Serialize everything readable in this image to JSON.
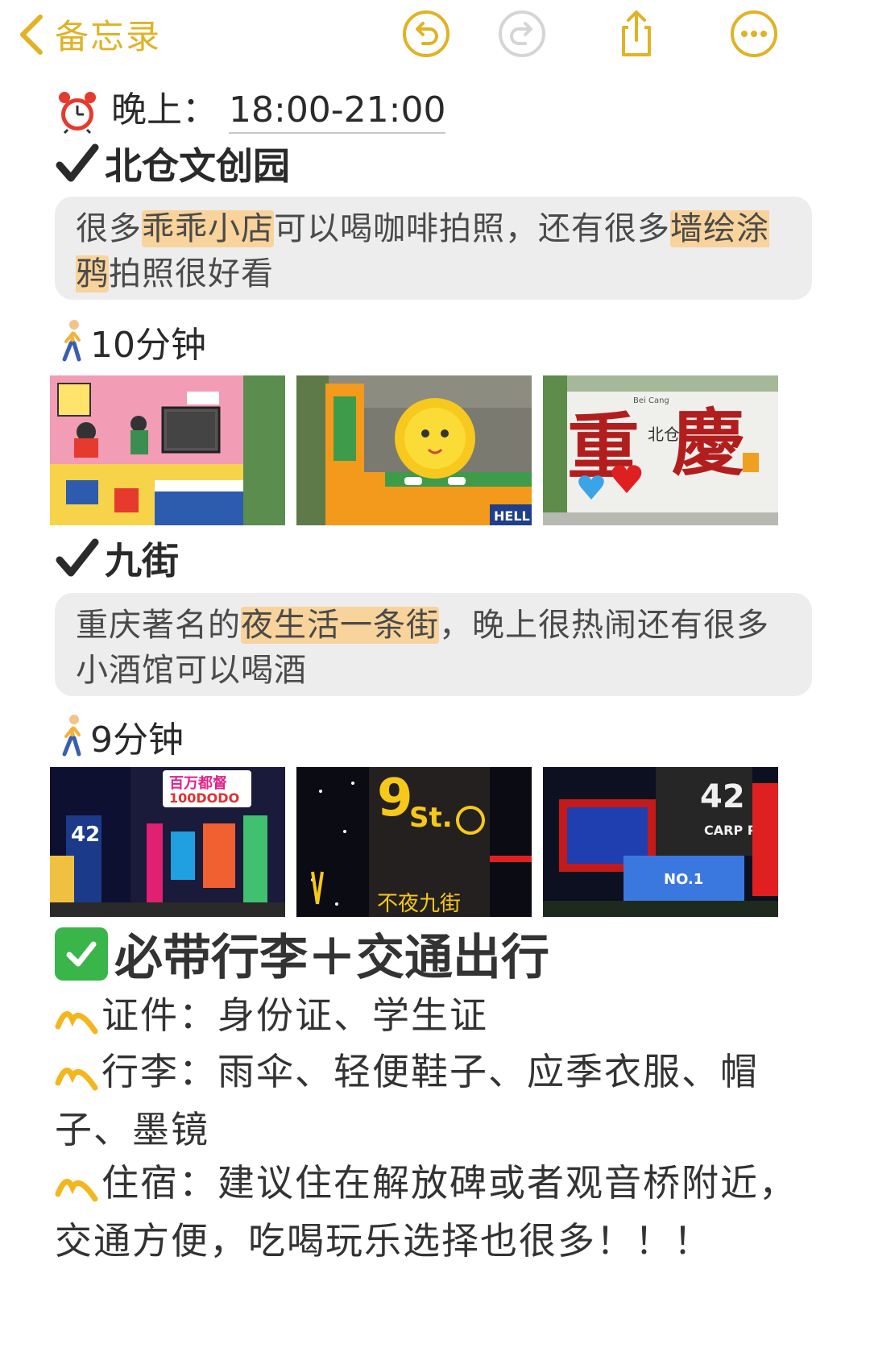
{
  "nav": {
    "back_label": "备忘录",
    "accent_color": "#e0b325",
    "icons": [
      "undo-icon",
      "redo-icon",
      "share-icon",
      "more-icon"
    ]
  },
  "schedule": {
    "time_prefix": "晚上：",
    "time_value": "18:00-21:00"
  },
  "spots": [
    {
      "name": "北仓文创园",
      "desc_parts": [
        "很多",
        "乖乖小店",
        "可以喝咖啡拍照，还有很多",
        "墙绘涂鸦",
        "拍照很好看"
      ],
      "walk_time": "10分钟",
      "photos": [
        "pink-mural-photo",
        "yellow-flower-sculpture-photo",
        "chongqing-beicang-sign-photo"
      ],
      "sign_text": [
        "重",
        "北仓",
        "慶",
        "Bei Cang"
      ],
      "photo_text": [
        "HELL"
      ]
    },
    {
      "name": "九街",
      "desc_parts": [
        "重庆著名的",
        "夜生活一条街",
        "，晚上很热闹还有很多小酒馆可以喝酒"
      ],
      "walk_time": "9分钟",
      "photos": [
        "neon-street-photo",
        "9st-sign-photo",
        "42-carp-pond-photo"
      ],
      "photo_text": [
        "百万都督",
        "100DODO",
        "42",
        "CARP POND",
        "9",
        "St.",
        "不夜九街",
        "NO.1"
      ]
    }
  ],
  "packing": {
    "title": "必带行李＋交通出行",
    "items": [
      {
        "label": "证件：",
        "text": "身份证、学生证"
      },
      {
        "label": "行李：",
        "text": "雨伞、轻便鞋子、应季衣服、帽子、墨镜"
      },
      {
        "label": "住宿：",
        "text": "建议住在解放碑或者观音桥附近，交通方便，吃喝玩乐选择也很多！！！"
      }
    ]
  },
  "colors": {
    "highlight": "#f8d39b",
    "note_bg": "#ededed",
    "check_green": "#3ab54a",
    "wave_yellow": "#f3b61f"
  }
}
